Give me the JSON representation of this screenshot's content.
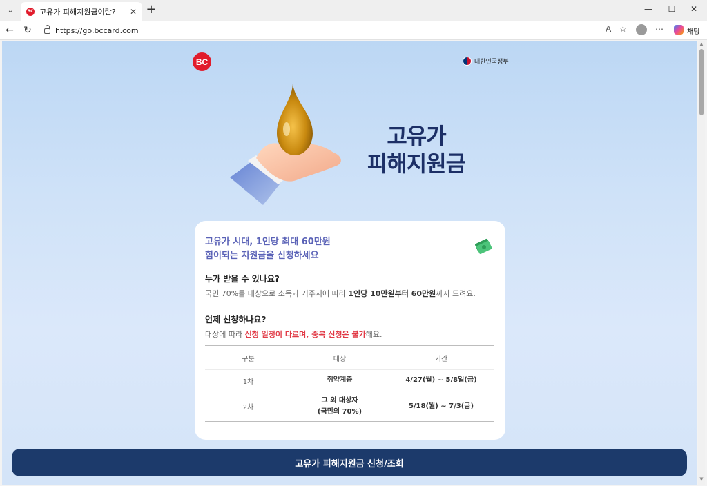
{
  "browser": {
    "tab_title": "고유가 피해지원금이란?",
    "url": "https://go.bccard.com",
    "chat_label": "채팅",
    "close_glyph": "✕",
    "new_tab_glyph": "+",
    "minimize_glyph": "—",
    "maximize_glyph": "☐",
    "back_glyph": "←",
    "reload_glyph": "↻",
    "read_aloud_glyph": "A",
    "favorite_glyph": "☆",
    "more_glyph": "⋯",
    "tab_list_glyph": "⌄"
  },
  "header": {
    "logo_text": "BC",
    "gov_label": "대한민국정부"
  },
  "hero": {
    "title_line1": "고유가",
    "title_line2": "피해지원금"
  },
  "card": {
    "headline_line1": "고유가 시대, 1인당 최대 60만원",
    "headline_line2": "힘이되는 지원금을 신청하세요",
    "who_question": "누가 받을 수 있나요?",
    "who_answer_pre": "국민 70%를 대상으로 소득과 거주지에 따라 ",
    "who_answer_bold": "1인당 10만원부터 60만원",
    "who_answer_post": "까지 드려요.",
    "when_question": "언제 신청하나요?",
    "when_answer_pre": "대상에 따라 ",
    "when_answer_red": "신청 일정이 다르며, 중복 신청은 불가",
    "when_answer_post": "해요.",
    "table": {
      "headers": [
        "구분",
        "대상",
        "기간"
      ],
      "rows": [
        {
          "round": "1차",
          "target_line1": "취약계층",
          "target_line2": "",
          "period": "4/27(월) ~ 5/8일(금)"
        },
        {
          "round": "2차",
          "target_line1": "그 외 대상자",
          "target_line2": "(국민의 70%)",
          "period": "5/18(월) ~ 7/3(금)"
        }
      ]
    }
  },
  "cta": {
    "label": "고유가 피해지원금 신청/조회"
  },
  "colors": {
    "brand_red": "#e11c2c",
    "navy": "#1c3a6b",
    "headline": "#5b63b7",
    "highlight_red": "#e13a46"
  }
}
